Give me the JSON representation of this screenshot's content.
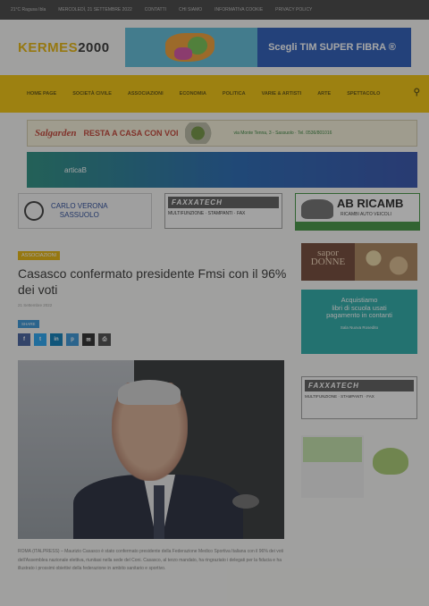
{
  "topbar": {
    "items": [
      "21°C  Ragusa Ibla",
      "MERCOLEDÌ, 21 SETTEMBRE 2022",
      "CONTATTI",
      "CHI SIAMO",
      "INFORMATIVA COOKIE",
      "PRIVACY POLICY"
    ]
  },
  "header": {
    "logo_part1": "KERMES",
    "logo_part2": "2000",
    "ad_tim_text": "Scegli TIM SUPER FIBRA ®"
  },
  "nav": {
    "items": [
      "HOME PAGE",
      "SOCIETÀ CIVILE",
      "ASSOCIAZIONI",
      "ECONOMIA",
      "POLITICA",
      "VARIE & ARTISTI",
      "ARTE",
      "SPETTACOLO"
    ],
    "search_icon": "search-icon"
  },
  "ads": {
    "salgarden_brand": "Salgarden",
    "salgarden_tag": "RESTA A CASA CON VOI",
    "salgarden_addr": "via Monte Tenna, 3 - Sassuolo · Tel. 0536/801016",
    "artica_text": "articaB",
    "volvo_text_1": "CARLO VERONA",
    "volvo_text_2": "SASSUOLO",
    "fax_logo": "FAXXATECH",
    "fax_text": "MULTIFUNZIONE · STAMPANTI · FAX",
    "ab_title": "AB RICAMB",
    "ab_sub": "RICAMBI AUTO VEICOLI",
    "sapor_text": "sapor DONNE",
    "acq_line1": "Acquistiamo",
    "acq_line2": "libri di scuola usati",
    "acq_line3": "pagamento in contanti",
    "acq_small": "Sala Nuova Rosedito"
  },
  "article": {
    "category": "ASSOCIAZIONI",
    "title": "Casasco confermato presidente Fmsi con il 96% dei voti",
    "meta": "21 Settembre 2022",
    "share_label": "SHARE",
    "share_buttons": [
      {
        "label": "f",
        "color": "#3b5998"
      },
      {
        "label": "t",
        "color": "#1da1f2"
      },
      {
        "label": "in",
        "color": "#0077b5"
      },
      {
        "label": "p",
        "color": "#2d8fd5"
      },
      {
        "label": "✉",
        "color": "#222222"
      },
      {
        "label": "⎙",
        "color": "#444444"
      }
    ],
    "body": "ROMA (ITALPRESS) – Maurizio Casasco è stato confermato presidente della Federazione Medico Sportiva Italiana con il 96% dei voti dell'Assemblea nazionale elettiva, riunitasi nella sede del Coni. Casasco, al terzo mandato, ha ringraziato i delegati per la fiducia e ha illustrato i prossimi obiettivi della federazione in ambito sanitario e sportivo."
  }
}
